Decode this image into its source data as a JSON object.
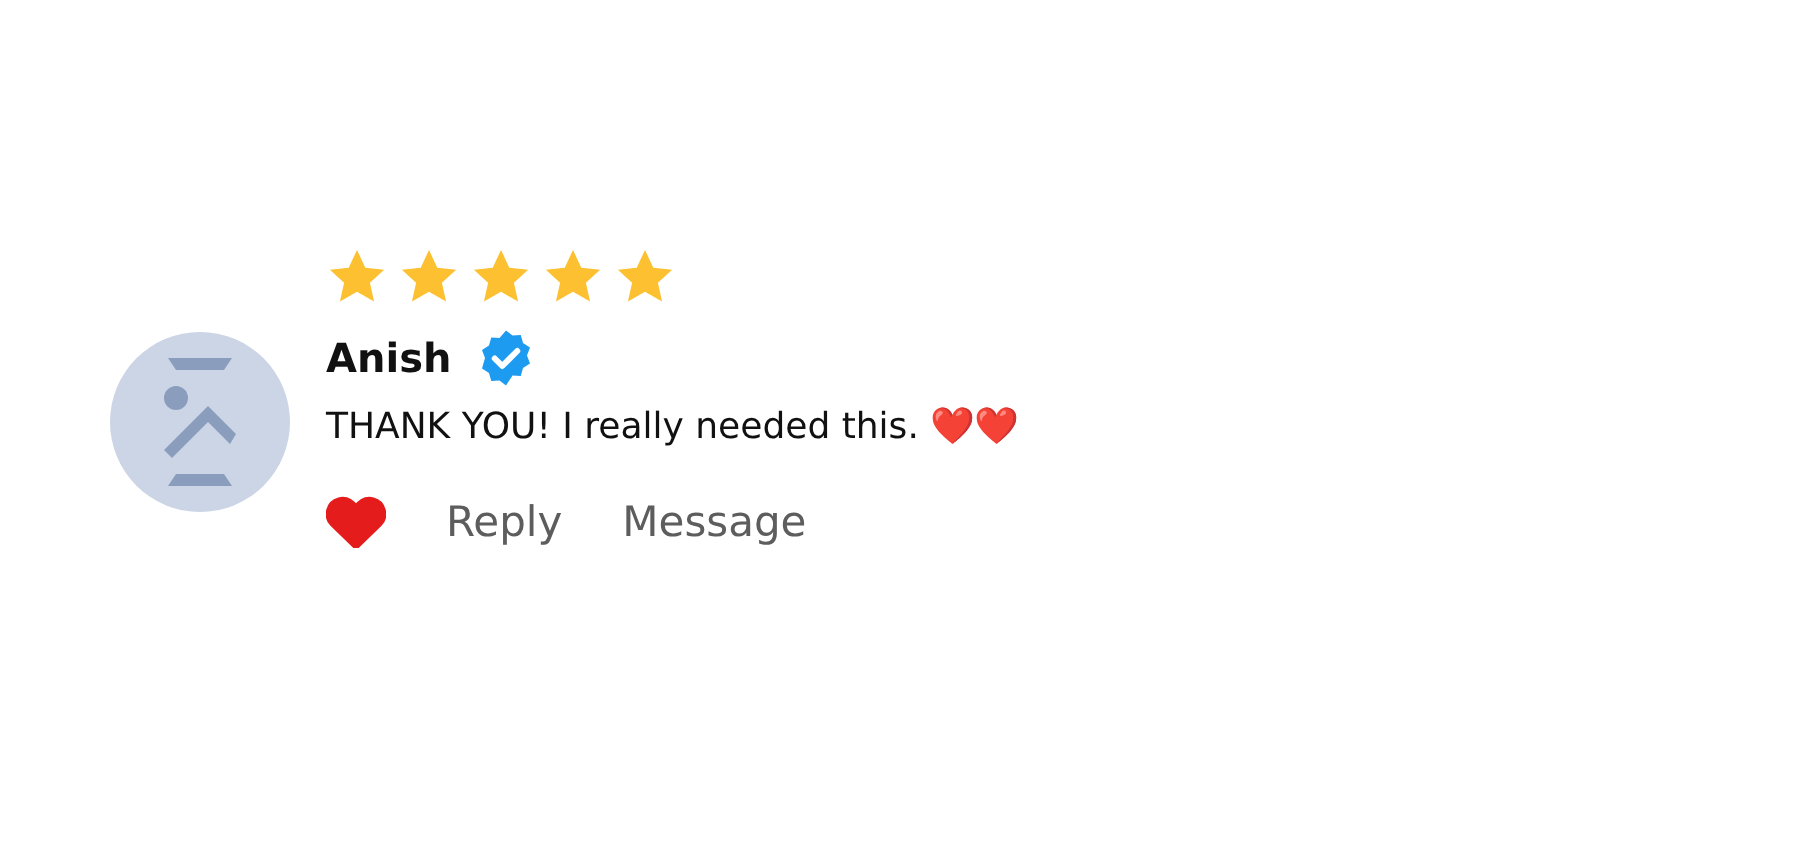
{
  "review": {
    "stars": 5,
    "author": "Anish",
    "verified": true,
    "text": "THANK YOU! I really needed this. ❤️❤️",
    "liked": true,
    "actions": [
      "Reply",
      "Message"
    ]
  }
}
